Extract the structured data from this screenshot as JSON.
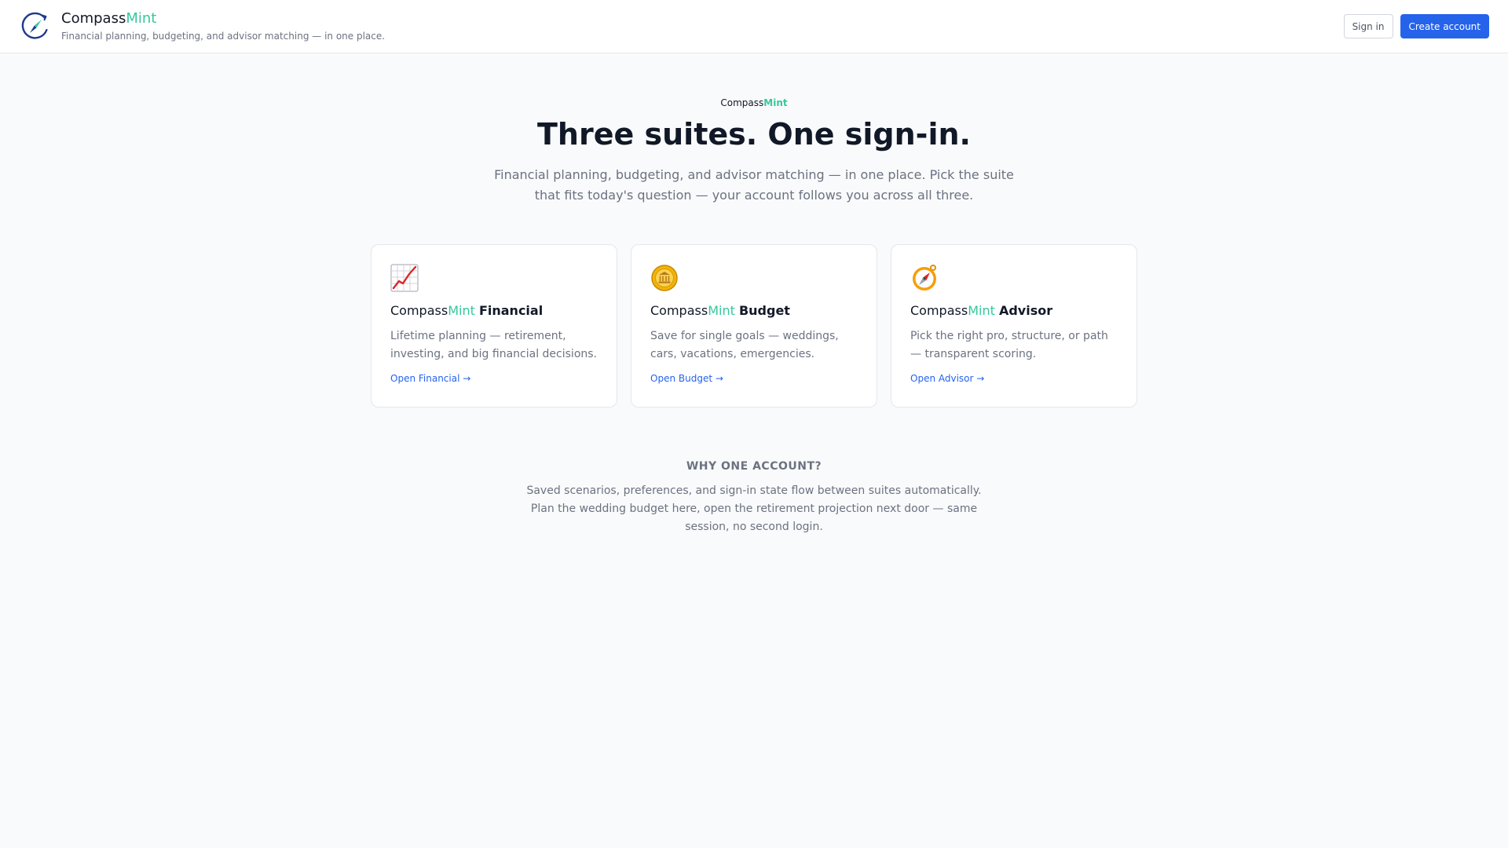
{
  "header": {
    "brand_prefix": "Compass",
    "brand_suffix": "Mint",
    "tagline": "Financial planning, budgeting, and advisor matching — in one place.",
    "signin_label": "Sign in",
    "create_label": "Create account"
  },
  "hero": {
    "eyebrow_prefix": "Compass",
    "eyebrow_suffix": "Mint",
    "headline": "Three suites. One sign-in.",
    "subtitle": "Financial planning, budgeting, and advisor matching — in one place. Pick the suite that fits today's question — your account follows you across all three."
  },
  "cards": [
    {
      "icon": "chart-increasing-icon",
      "brand_prefix": "Compass",
      "brand_suffix": "Mint",
      "name": "Financial",
      "description": "Lifetime planning — retirement, investing, and big financial decisions.",
      "link": "Open Financial →"
    },
    {
      "icon": "coin-icon",
      "brand_prefix": "Compass",
      "brand_suffix": "Mint",
      "name": "Budget",
      "description": "Save for single goals — weddings, cars, vacations, emergencies.",
      "link": "Open Budget →"
    },
    {
      "icon": "compass-icon",
      "brand_prefix": "Compass",
      "brand_suffix": "Mint",
      "name": "Advisor",
      "description": "Pick the right pro, structure, or path — transparent scoring.",
      "link": "Open Advisor →"
    }
  ],
  "why": {
    "title": "WHY ONE ACCOUNT?",
    "text": "Saved scenarios, preferences, and sign-in state flow between suites automatically. Plan the wedding budget here, open the retirement projection next door — same session, no second login."
  },
  "colors": {
    "accent_mint": "#34c89a",
    "primary_blue": "#2563eb",
    "text_dark": "#111827",
    "text_muted": "#6b7280",
    "background": "#f9fafb"
  }
}
